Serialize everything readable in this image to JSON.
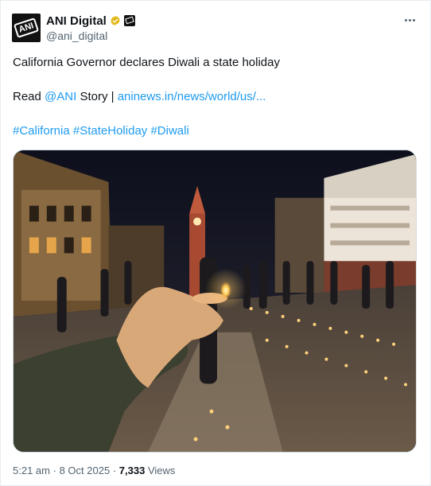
{
  "author": {
    "display_name": "ANI Digital",
    "handle": "@ani_digital",
    "avatar_text": "ANI",
    "verified_color": "#e2b719"
  },
  "tweet": {
    "headline": "California Governor declares Diwali a state holiday",
    "read_prefix": "Read",
    "mention": "@ANI",
    "story_word": "Story |",
    "link_text": "aninews.in/news/world/us/...",
    "hashtags": [
      "#California",
      "#StateHoliday",
      "#Diwali"
    ]
  },
  "meta": {
    "time": "5:21 am",
    "separator": "·",
    "date": "8 Oct 2025",
    "views_count": "7,333",
    "views_label": "Views"
  },
  "colors": {
    "link": "#1d9bf0",
    "secondary_text": "#536471"
  },
  "icons": {
    "more": "more-horizontal-icon",
    "verified": "verified-badge-icon",
    "affiliate": "ani-affiliate-badge-icon"
  }
}
